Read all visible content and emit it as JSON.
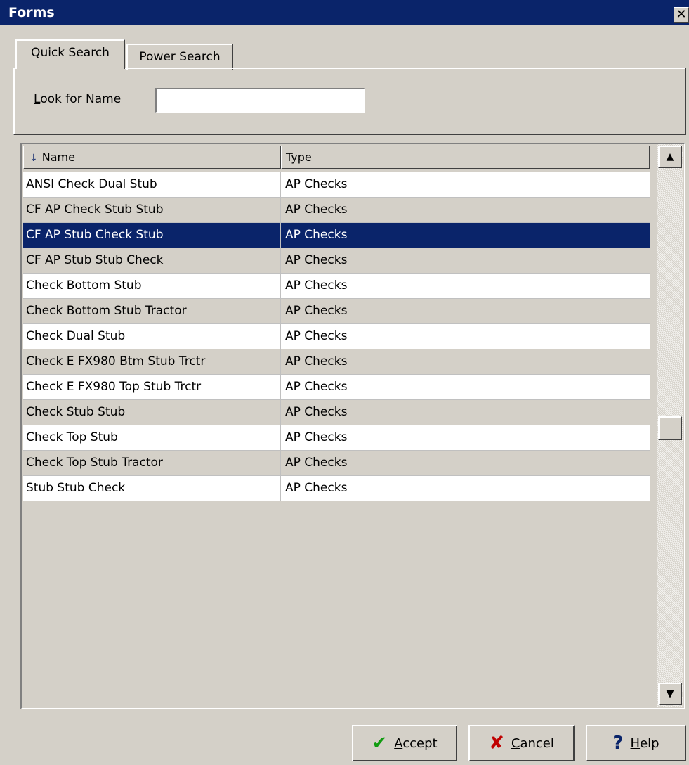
{
  "window": {
    "title": "Forms",
    "close_glyph": "✕"
  },
  "tabs": [
    {
      "label_first": "Q",
      "label_rest": "uick Search"
    },
    {
      "label_first": "P",
      "label_rest": "ower Search"
    }
  ],
  "search": {
    "label_first": "L",
    "label_rest": "ook for Name",
    "value": ""
  },
  "table": {
    "columns": [
      "Name",
      "Type"
    ],
    "sort_indicator": "↓",
    "selected_index": 2,
    "rows": [
      {
        "name": "ANSI Check Dual Stub",
        "type": "AP Checks"
      },
      {
        "name": "CF AP Check Stub Stub",
        "type": "AP Checks"
      },
      {
        "name": "CF AP Stub Check Stub",
        "type": "AP Checks"
      },
      {
        "name": "CF AP Stub Stub Check",
        "type": "AP Checks"
      },
      {
        "name": "Check Bottom Stub",
        "type": "AP Checks"
      },
      {
        "name": "Check Bottom Stub Tractor",
        "type": "AP Checks"
      },
      {
        "name": "Check Dual Stub",
        "type": "AP Checks"
      },
      {
        "name": "Check E FX980 Btm Stub Trctr",
        "type": "AP Checks"
      },
      {
        "name": "Check E FX980 Top Stub Trctr",
        "type": "AP Checks"
      },
      {
        "name": "Check Stub Stub",
        "type": "AP Checks"
      },
      {
        "name": "Check Top Stub",
        "type": "AP Checks"
      },
      {
        "name": "Check Top Stub Tractor",
        "type": "AP Checks"
      },
      {
        "name": "Stub Stub Check",
        "type": "AP Checks"
      }
    ]
  },
  "scrollbar": {
    "up_glyph": "▲",
    "down_glyph": "▼"
  },
  "buttons": {
    "accept": {
      "label_first": "A",
      "label_rest": "ccept",
      "icon": "check-icon",
      "glyph": "✔"
    },
    "cancel": {
      "label_first": "C",
      "label_rest": "ancel",
      "icon": "x-icon",
      "glyph": "✘"
    },
    "help": {
      "label_first": "H",
      "label_rest": "elp",
      "icon": "question-icon",
      "glyph": "?"
    }
  },
  "colors": {
    "titlebar": "#0a246a",
    "selection": "#0a246a",
    "face": "#d4d0c8"
  }
}
